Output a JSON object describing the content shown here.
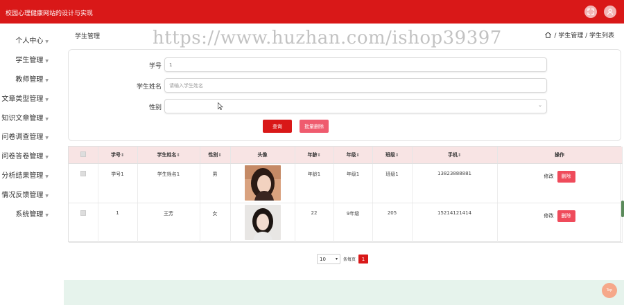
{
  "header": {
    "title": "校园心理健康网站的设计与实现"
  },
  "sidebar": {
    "items": [
      {
        "label": "个人中心"
      },
      {
        "label": "学生管理"
      },
      {
        "label": "教师管理"
      },
      {
        "label": "文章类型管理"
      },
      {
        "label": "知识文章管理"
      },
      {
        "label": "问卷调查管理"
      },
      {
        "label": "问卷答卷管理"
      },
      {
        "label": "分析结果管理"
      },
      {
        "label": "情况反馈管理"
      },
      {
        "label": "系统管理"
      }
    ]
  },
  "breadcrumb": {
    "title": "学生管理",
    "path": "/ 学生管理 / 学生列表"
  },
  "watermark": "https://www.huzhan.com/ishop39397",
  "search": {
    "fields": {
      "student_no": {
        "label": "学号",
        "value": "1"
      },
      "student_name": {
        "label": "学生姓名",
        "placeholder": "请输入学生姓名"
      },
      "gender": {
        "label": "性别"
      }
    },
    "search_label": "查询",
    "bulk_delete_label": "批量删除"
  },
  "table": {
    "headers": [
      "学号",
      "学生姓名",
      "性别",
      "头像",
      "年龄",
      "年级",
      "班级",
      "手机",
      "操作"
    ],
    "rows": [
      {
        "student_no": "学号1",
        "name": "学生姓名1",
        "gender": "男",
        "age": "年龄1",
        "grade": "年级1",
        "class": "班级1",
        "phone": "13823888881",
        "edit": "修改",
        "delete": "删除"
      },
      {
        "student_no": "1",
        "name": "王芳",
        "gender": "女",
        "age": "22",
        "grade": "9年级",
        "class": "205",
        "phone": "15214121414",
        "edit": "修改",
        "delete": "删除"
      }
    ]
  },
  "pager": {
    "page_size": "10",
    "page_size_label": "条每页",
    "current_page": "1"
  },
  "back_to_top": "Top",
  "colors": {
    "primary": "#d91818",
    "danger": "#ef4b5b",
    "header_row": "#f8e4e4"
  }
}
